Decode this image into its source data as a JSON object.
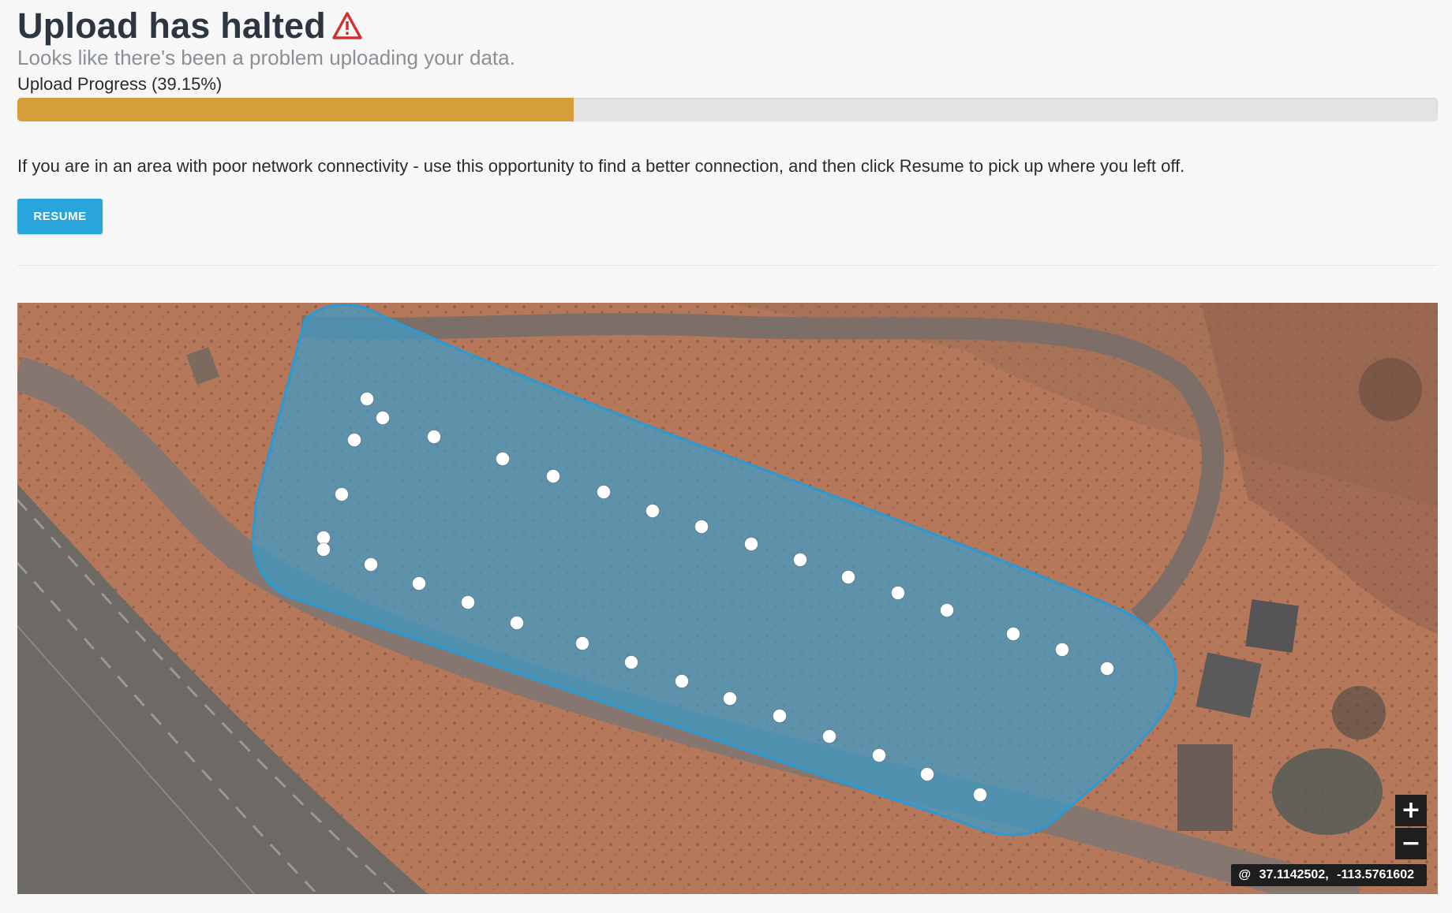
{
  "header": {
    "title": "Upload has halted",
    "warning_icon": "warning-triangle-icon",
    "subtitle": "Looks like there's been a problem uploading your data."
  },
  "progress": {
    "label": "Upload Progress (39.15%)",
    "value_percent": 39.15,
    "fill_color": "#d69e3a"
  },
  "message": "If you are in an area with poor network connectivity - use this opportunity to find a better connection, and then click Resume to pick up where you left off.",
  "actions": {
    "resume_label": "RESUME",
    "accent_color": "#2aa5dc"
  },
  "map": {
    "zoom_in_label": "+",
    "zoom_out_label": "−",
    "coords": {
      "prefix": "@",
      "lat": "37.1142502,",
      "lng": "-113.5761602"
    }
  }
}
